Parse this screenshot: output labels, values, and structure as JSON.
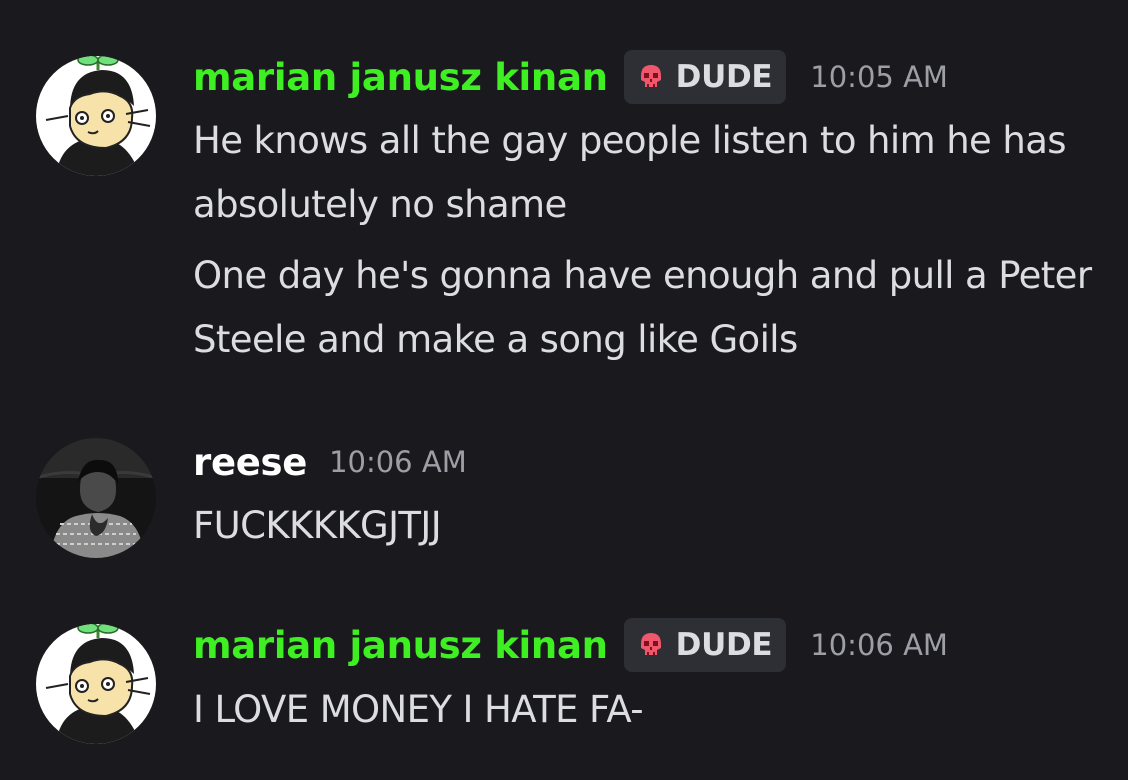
{
  "colors": {
    "background": "#1a1a1e",
    "green_name": "#3ef021",
    "white_name": "#ffffff",
    "tag_bg": "#2e2f35",
    "skull": "#f0576b",
    "message_text": "#dcdde1",
    "timestamp": "#9d9ea6"
  },
  "messages": [
    {
      "username": "marian janusz kinan",
      "tag": {
        "icon": "skull-icon",
        "label": "DUDE"
      },
      "timestamp": "10:05 AM",
      "lines": [
        "He knows all the gay people listen to him he has absolutely no shame",
        "One day he's gonna have enough and pull a Peter Steele and make a song like Goils"
      ]
    },
    {
      "username": "reese",
      "timestamp": "10:06 AM",
      "lines": [
        "FUCKKKKGJTJJ"
      ]
    },
    {
      "username": "marian janusz kinan",
      "tag": {
        "icon": "skull-icon",
        "label": "DUDE"
      },
      "timestamp": "10:06 AM",
      "lines": [
        "I LOVE MONEY I HATE FA-"
      ]
    }
  ]
}
